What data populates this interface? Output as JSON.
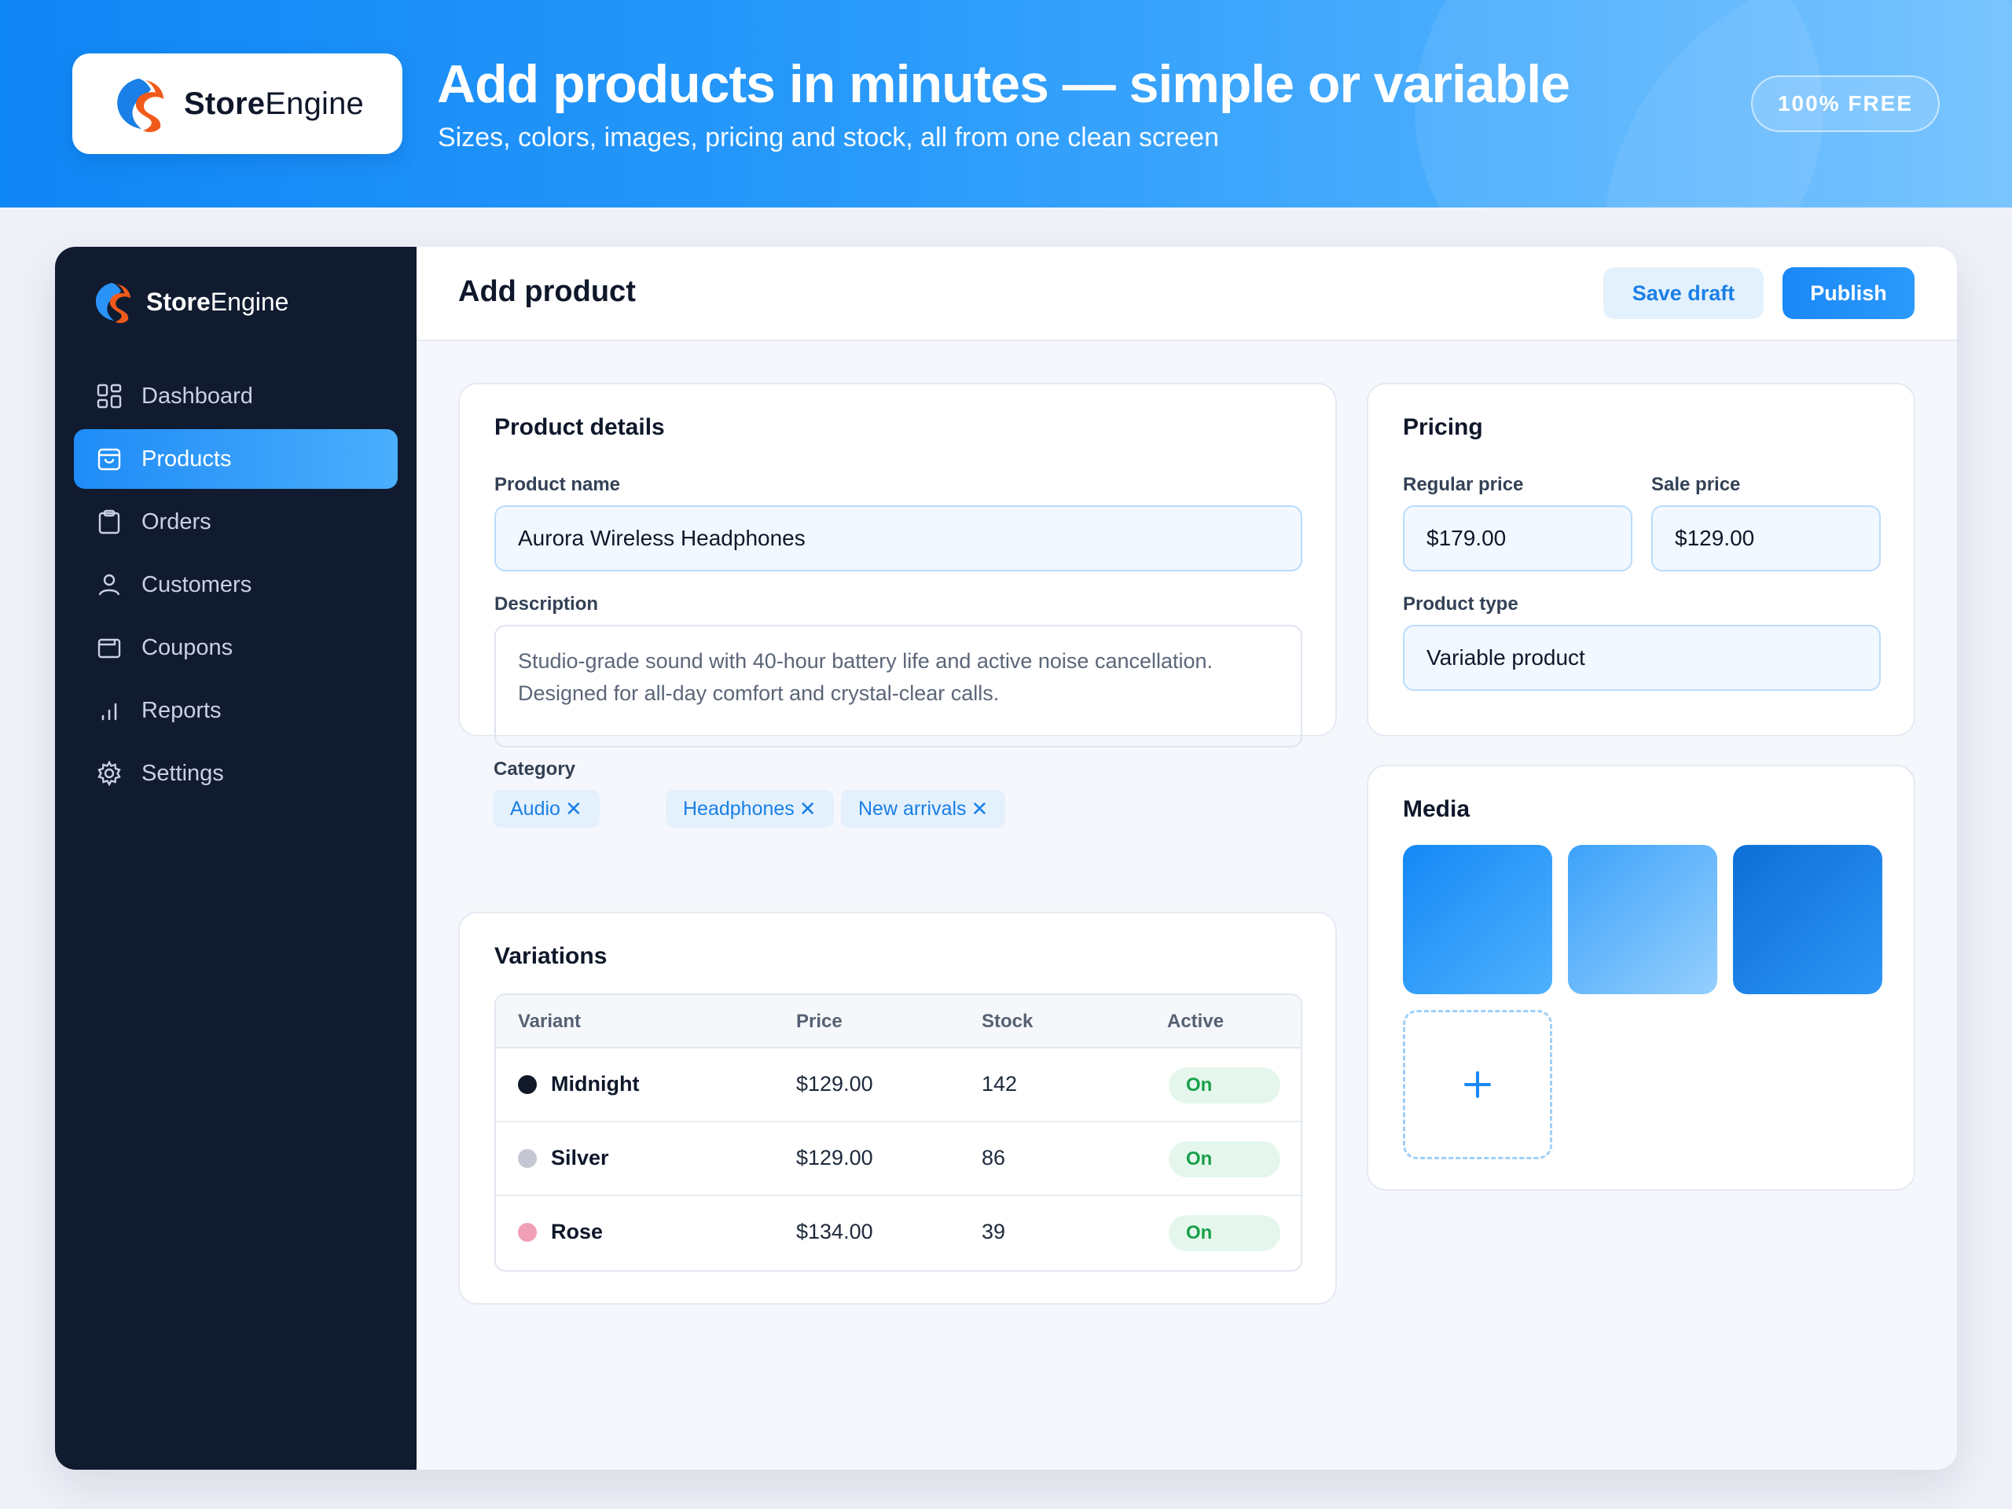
{
  "brand": {
    "name_bold": "Store",
    "name_regular": "Engine"
  },
  "banner": {
    "headline": "Add products in minutes — simple or variable",
    "subline": "Sizes, colors, images, pricing and stock, all from one clean screen",
    "badge": "100% FREE"
  },
  "sidebar": {
    "items": [
      {
        "label": "Dashboard",
        "icon": "dashboard-icon",
        "active": false
      },
      {
        "label": "Products",
        "icon": "bag-icon",
        "active": true
      },
      {
        "label": "Orders",
        "icon": "clipboard-icon",
        "active": false
      },
      {
        "label": "Customers",
        "icon": "user-icon",
        "active": false
      },
      {
        "label": "Coupons",
        "icon": "coupon-icon",
        "active": false
      },
      {
        "label": "Reports",
        "icon": "bar-chart-icon",
        "active": false
      },
      {
        "label": "Settings",
        "icon": "gear-icon",
        "active": false
      }
    ]
  },
  "header": {
    "title": "Add product",
    "save_label": "Save draft",
    "publish_label": "Publish"
  },
  "details": {
    "title": "Product details",
    "name_label": "Product name",
    "name_value": "Aurora Wireless Headphones",
    "desc_label": "Description",
    "desc_line1": "Studio-grade sound with 40-hour battery life and active noise cancellation.",
    "desc_line2": "Designed for all-day comfort and crystal-clear calls.",
    "category_label": "Category",
    "categories": [
      "Audio",
      "Headphones",
      "New arrivals"
    ]
  },
  "variations": {
    "title": "Variations",
    "columns": [
      "Variant",
      "Price",
      "Stock",
      "Active"
    ],
    "rows": [
      {
        "variant": "Midnight",
        "price": "$129.00",
        "stock": "142",
        "active": "On",
        "color": "#111827"
      },
      {
        "variant": "Silver",
        "price": "$129.00",
        "stock": "86",
        "active": "On",
        "color": "#c4c8d2"
      },
      {
        "variant": "Rose",
        "price": "$134.00",
        "stock": "39",
        "active": "On",
        "color": "#f0a0b4"
      }
    ]
  },
  "pricing": {
    "title": "Pricing",
    "regular_label": "Regular price",
    "regular_value": "$179.00",
    "sale_label": "Sale price",
    "sale_value": "$129.00",
    "type_label": "Product type",
    "type_value": "Variable product"
  },
  "media": {
    "title": "Media",
    "add_icon": "plus-icon"
  },
  "colors": {
    "accent": "#1a88f6",
    "sidebar": "#101b30",
    "success": "#18a04a"
  }
}
